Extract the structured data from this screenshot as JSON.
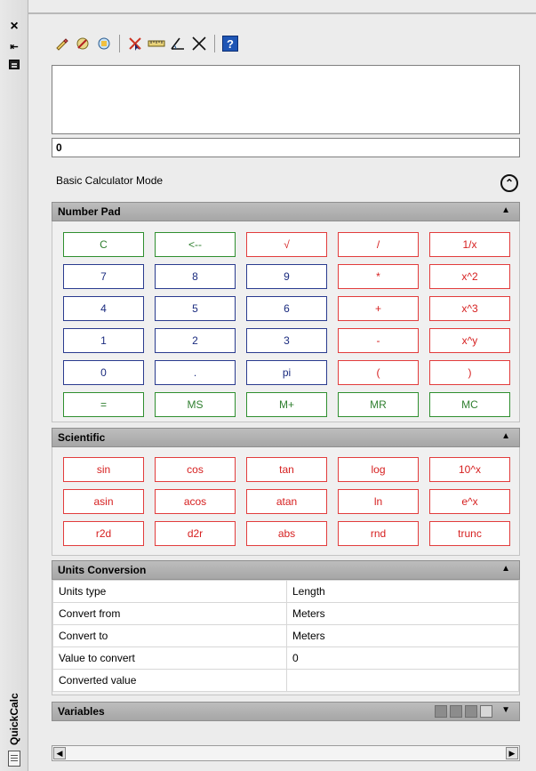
{
  "window": {
    "title": "QuickCalc",
    "close_glyph": "×",
    "autohide_glyph": "⇤",
    "properties_glyph": "▤"
  },
  "toolbar": {
    "icons": [
      "clear-icon",
      "clear-history-icon",
      "paste-to-command-line-icon",
      "get-coordinates-icon",
      "distance-between-two-points-icon",
      "angle-of-line-icon",
      "intersection-of-four-points-icon",
      "help-icon"
    ],
    "help_glyph": "?"
  },
  "history": {
    "lines": []
  },
  "input": {
    "value": "0"
  },
  "mode": {
    "label": "Basic Calculator Mode",
    "toggle_glyph": "⌃"
  },
  "number_pad": {
    "title": "Number Pad",
    "collapse_glyph": "▲",
    "keys": [
      {
        "label": "C",
        "color": "green"
      },
      {
        "label": "<--",
        "color": "green"
      },
      {
        "label": "√",
        "color": "red"
      },
      {
        "label": "/",
        "color": "red"
      },
      {
        "label": "1/x",
        "color": "red"
      },
      {
        "label": "7",
        "color": "blue"
      },
      {
        "label": "8",
        "color": "blue"
      },
      {
        "label": "9",
        "color": "blue"
      },
      {
        "label": "*",
        "color": "red"
      },
      {
        "label": "x^2",
        "color": "red"
      },
      {
        "label": "4",
        "color": "blue"
      },
      {
        "label": "5",
        "color": "blue"
      },
      {
        "label": "6",
        "color": "blue"
      },
      {
        "label": "+",
        "color": "red"
      },
      {
        "label": "x^3",
        "color": "red"
      },
      {
        "label": "1",
        "color": "blue"
      },
      {
        "label": "2",
        "color": "blue"
      },
      {
        "label": "3",
        "color": "blue"
      },
      {
        "label": "-",
        "color": "red"
      },
      {
        "label": "x^y",
        "color": "red"
      },
      {
        "label": "0",
        "color": "blue"
      },
      {
        "label": ".",
        "color": "blue"
      },
      {
        "label": "pi",
        "color": "blue"
      },
      {
        "label": "(",
        "color": "red"
      },
      {
        "label": ")",
        "color": "red"
      },
      {
        "label": "=",
        "color": "green"
      },
      {
        "label": "MS",
        "color": "green"
      },
      {
        "label": "M+",
        "color": "green"
      },
      {
        "label": "MR",
        "color": "green"
      },
      {
        "label": "MC",
        "color": "green"
      }
    ]
  },
  "scientific": {
    "title": "Scientific",
    "collapse_glyph": "▲",
    "keys": [
      {
        "label": "sin",
        "color": "red"
      },
      {
        "label": "cos",
        "color": "red"
      },
      {
        "label": "tan",
        "color": "red"
      },
      {
        "label": "log",
        "color": "red"
      },
      {
        "label": "10^x",
        "color": "red"
      },
      {
        "label": "asin",
        "color": "red"
      },
      {
        "label": "acos",
        "color": "red"
      },
      {
        "label": "atan",
        "color": "red"
      },
      {
        "label": "ln",
        "color": "red"
      },
      {
        "label": "e^x",
        "color": "red"
      },
      {
        "label": "r2d",
        "color": "red"
      },
      {
        "label": "d2r",
        "color": "red"
      },
      {
        "label": "abs",
        "color": "red"
      },
      {
        "label": "rnd",
        "color": "red"
      },
      {
        "label": "trunc",
        "color": "red"
      }
    ]
  },
  "units": {
    "title": "Units Conversion",
    "collapse_glyph": "▲",
    "rows": [
      {
        "label": "Units type",
        "value": "Length"
      },
      {
        "label": "Convert from",
        "value": "Meters"
      },
      {
        "label": "Convert to",
        "value": "Meters"
      },
      {
        "label": "Value to convert",
        "value": "0"
      },
      {
        "label": "Converted value",
        "value": ""
      }
    ]
  },
  "variables": {
    "title": "Variables",
    "expand_glyph": "▼",
    "icons": [
      "new-variable-icon",
      "edit-variable-icon",
      "delete-variable-icon",
      "variable-to-input-icon"
    ]
  },
  "scrollbar": {
    "left_glyph": "◀",
    "right_glyph": "▶"
  },
  "colors": {
    "green": "#2f8f2f",
    "blue": "#2a3b8f",
    "red": "#e23c3c",
    "header": "#b3b3b3"
  }
}
